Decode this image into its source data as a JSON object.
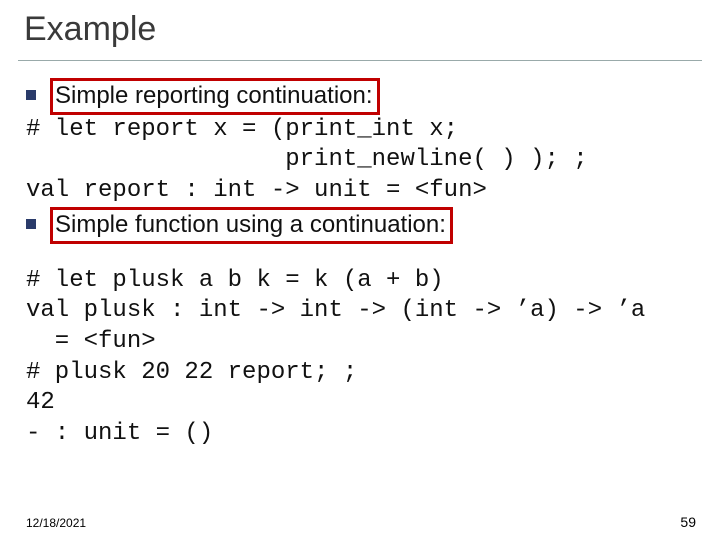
{
  "title": "Example",
  "block1": {
    "bullet": "Simple reporting continuation:",
    "code1": "# let report x = (print_int x;",
    "code2": "                  print_newline( ) ); ;",
    "code3": "val report : int -> unit = <fun>",
    "bullet2": "Simple function using a continuation:"
  },
  "block2": {
    "code1": "# let plusk a b k = k (a + b)",
    "code2": "val plusk : int -> int -> (int -> ’a) -> ’a",
    "code3": "  = <fun>",
    "code4": "# plusk 20 22 report; ;",
    "code5": "42",
    "code6": "- : unit = ()"
  },
  "footer": {
    "date": "12/18/2021",
    "page": "59"
  }
}
